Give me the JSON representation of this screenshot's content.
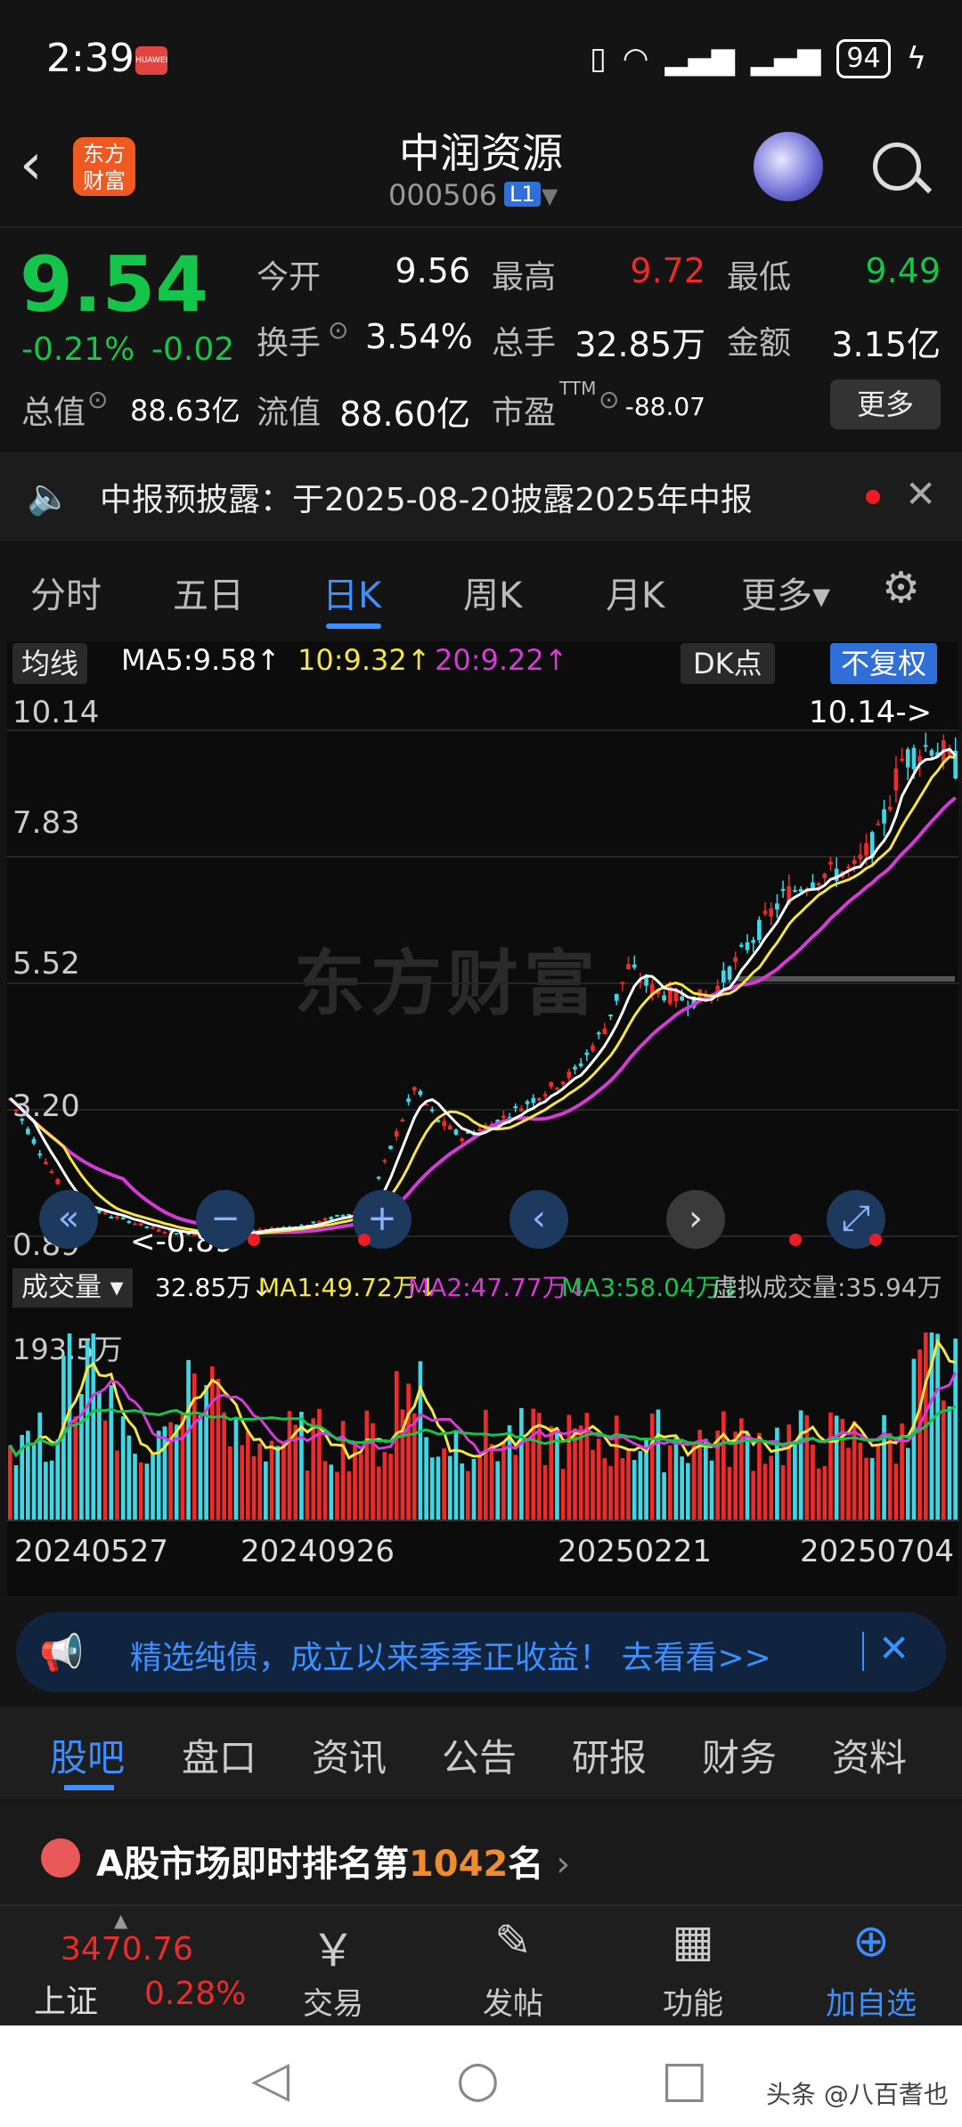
{
  "status": {
    "time": "2:39",
    "brand": "HUAWEI",
    "battery": "94",
    "icons": [
      "vibrate-icon",
      "wifi-icon",
      "4g-signal-icon",
      "4g-signal-icon",
      "battery-icon",
      "charging-icon"
    ]
  },
  "header": {
    "logo_line1": "东方",
    "logo_line2": "财富",
    "title": "中润资源",
    "code": "000506",
    "badge": "L1"
  },
  "quote": {
    "price": "9.54",
    "pct": "-0.21%",
    "chg": "-0.02",
    "open_label": "今开",
    "open": "9.56",
    "high_label": "最高",
    "high": "9.72",
    "low_label": "最低",
    "low": "9.49",
    "turnover_label": "换手",
    "turnover": "3.54%",
    "volume_label": "总手",
    "volume": "32.85万",
    "amount_label": "金额",
    "amount": "3.15亿",
    "mktcap_label": "总值",
    "mktcap": "88.63亿",
    "float_label": "流值",
    "float": "88.60亿",
    "pe_label": "市盈",
    "pe_sup": "TTM",
    "pe": "-88.07",
    "more": "更多"
  },
  "notice": {
    "text": "中报预披露：于2025-08-20披露2025年中报"
  },
  "tabs": [
    {
      "label": "分时"
    },
    {
      "label": "五日"
    },
    {
      "label": "日K"
    },
    {
      "label": "周K"
    },
    {
      "label": "月K"
    },
    {
      "label": "更多▾"
    }
  ],
  "chart_toolbar": {
    "ma": "均线",
    "ma5": "MA5:9.58↑",
    "ma10": "10:9.32↑",
    "ma20": "20:9.22↑",
    "dk": "DK点",
    "fq": "不复权"
  },
  "watermark": "东方财富",
  "price_axis": [
    "10.14",
    "7.83",
    "5.52",
    "3.20",
    "0.89"
  ],
  "annotations": {
    "high": "10.14->",
    "low": "<-0.89"
  },
  "volume": {
    "label": "成交量",
    "vol": "32.85万↓",
    "ma1": "MA1:49.72万↓",
    "ma2": "MA2:47.77万↓",
    "ma3": "MA3:58.04万↓",
    "virtual": "虚拟成交量:35.94万",
    "axis_top": "193.5万"
  },
  "dates": [
    "20240527",
    "20240926",
    "20250221",
    "20250704"
  ],
  "ad": {
    "text": "精选纯债，成立以来季季正收益！ 去看看>>"
  },
  "section_tabs": [
    {
      "label": "股吧"
    },
    {
      "label": "盘口"
    },
    {
      "label": "资讯"
    },
    {
      "label": "公告"
    },
    {
      "label": "研报"
    },
    {
      "label": "财务"
    },
    {
      "label": "资料"
    }
  ],
  "rank": {
    "prefix": "A股市场即时排名第",
    "num": "1042",
    "suffix": "名"
  },
  "bottom": {
    "index_value": "3470.76",
    "index_name": "上证",
    "index_pct": "0.28%",
    "items": [
      {
        "label": "交易",
        "icon": "￥"
      },
      {
        "label": "发帖",
        "icon": "✎"
      },
      {
        "label": "功能",
        "icon": "▦"
      },
      {
        "label": "加自选",
        "icon": "⊕"
      }
    ]
  },
  "credit": "头条 @八百耆也",
  "colors": {
    "up": "#ee2a2a",
    "down": "#15c44b",
    "accent": "#3d8fff",
    "ma5": "#ffffff",
    "ma10": "#f5e642",
    "ma20": "#d63ad6"
  }
}
